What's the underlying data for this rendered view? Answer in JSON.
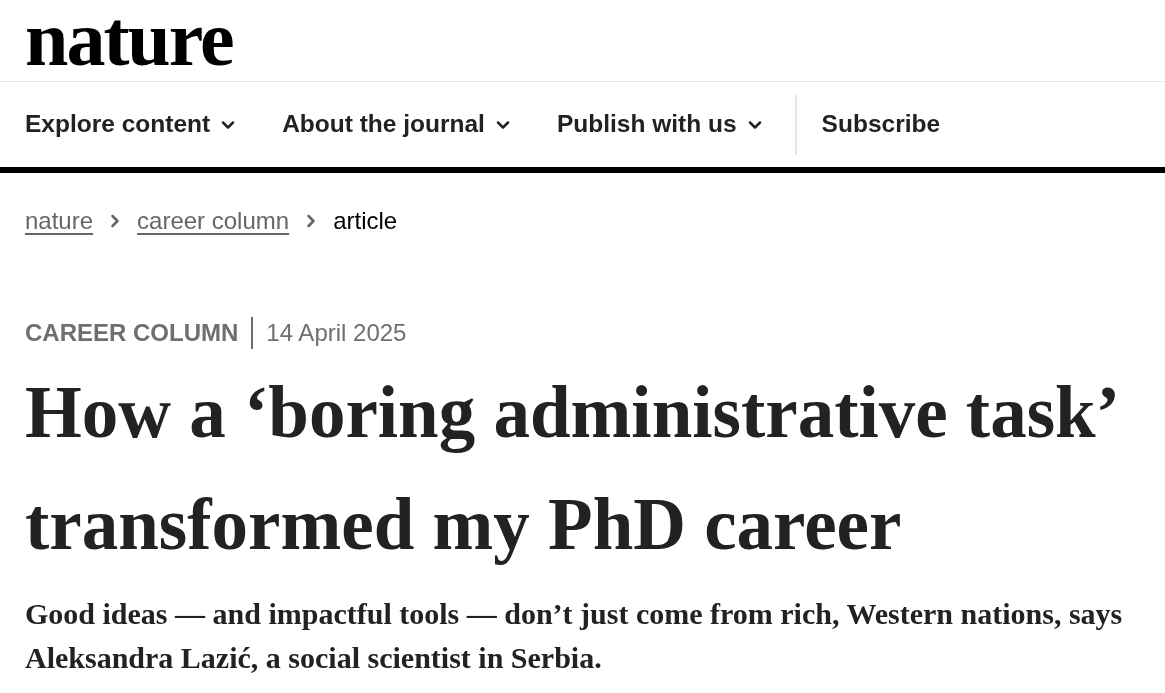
{
  "header": {
    "logo": "nature"
  },
  "nav": {
    "items": [
      {
        "label": "Explore content",
        "dropdown": true
      },
      {
        "label": "About the journal",
        "dropdown": true
      },
      {
        "label": "Publish with us",
        "dropdown": true
      }
    ],
    "subscribe": "Subscribe"
  },
  "breadcrumb": [
    {
      "label": "nature",
      "kind": "link"
    },
    {
      "label": "career column",
      "kind": "link"
    },
    {
      "label": "article",
      "kind": "current"
    }
  ],
  "article": {
    "type": "CAREER COLUMN",
    "date": "14 April 2025",
    "title": "How a ‘boring administrative task’ transformed my PhD career",
    "standfirst": "Good ideas — and impactful tools — don’t just come from rich, Western nations, says Aleksandra Lazić, a social scientist in Serbia."
  }
}
